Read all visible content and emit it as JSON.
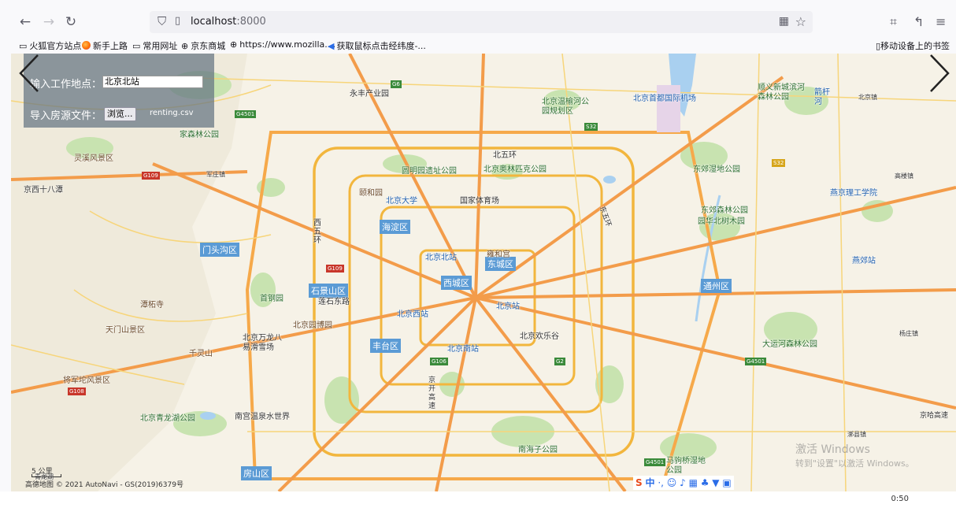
{
  "browser": {
    "url_host": "localhost",
    "url_port": ":8000"
  },
  "bookmarks": {
    "items": [
      "火狐官方站点",
      "新手上路",
      "常用网址",
      "京东商城",
      "https://www.mozilla....",
      "获取鼠标点击经纬度-..."
    ],
    "mobile": "移动设备上的书签"
  },
  "panel": {
    "work_label": "输入工作地点：",
    "work_value": "北京北站",
    "import_label": "导入房源文件：",
    "browse_label": "浏览...",
    "file_name": "renting.csv"
  },
  "map": {
    "scale": "5 公里",
    "attribution": "高德地图 © 2021 AutoNavi - GS(2019)6379号",
    "districts": [
      "门头沟区",
      "海淀区",
      "东城区",
      "西城区",
      "石景山区",
      "丰台区",
      "通州区",
      "房山区"
    ],
    "places": [
      "永丰产业园",
      "北京温榆河公园规划区",
      "北京首都国际机场",
      "顺义新城滨河森林公园",
      "北京镇",
      "箭杆河",
      "灵溪风景区",
      "京西十八潭",
      "家森林公园",
      "军庄镇",
      "北五环",
      "圆明园遗址公园",
      "北京奥林匹克公园",
      "东郊湿地公园",
      "高楼镇",
      "燕京理工学院",
      "颐和园",
      "北京大学",
      "国家体育场",
      "东郊森林公园",
      "园华北树木园",
      "西五环",
      "北京北站",
      "雍和宫",
      "燕郊站",
      "潭柘寺",
      "首钢园",
      "莲石东路",
      "北京西站",
      "北京站",
      "天门山景区",
      "北京园博园",
      "北京万龙八易滑雪场",
      "北京欢乐谷",
      "杨庄镇",
      "大运河森林公园",
      "千灵山",
      "北京南站",
      "将军坨风景区",
      "北京青龙湖公园",
      "南宫温泉水世界",
      "南海子公园",
      "马驹桥湿地公园",
      "青龙湖",
      "京开高速",
      "东五环",
      "漷县镇",
      "京哈高速"
    ],
    "windows_watermark_title": "激活 Windows",
    "windows_watermark_sub": "转到\"设置\"以激活 Windows。"
  },
  "ime": {
    "lang": "中"
  },
  "taskbar": {
    "clock": "0:50"
  }
}
